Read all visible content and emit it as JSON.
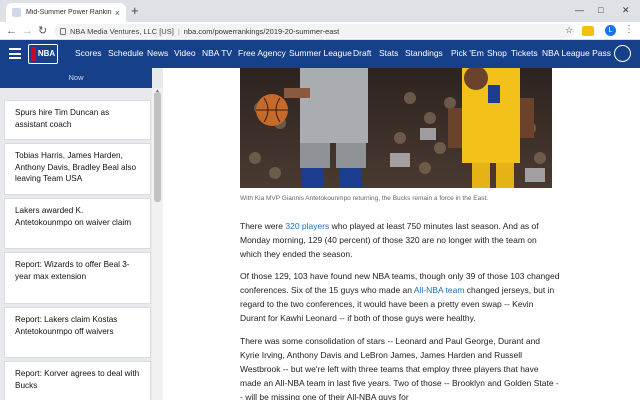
{
  "browser": {
    "tab_title": "Mid-Summer Power Rankings: M",
    "tab_close": "×",
    "new_tab": "+",
    "window_controls": [
      "—",
      "□",
      "✕"
    ],
    "site_name": "NBA Media Ventures, LLC [US]",
    "separator": "|",
    "url": "nba.com/powerrankings/2019-20-summer-east",
    "avatar_letter": "L"
  },
  "nav": {
    "links": [
      "Scores",
      "Schedule",
      "News",
      "Video",
      "NBA TV",
      "Free Agency",
      "Summer League",
      "Draft",
      "Stats",
      "Standings",
      "Pick 'Em",
      "Shop",
      "Tickets",
      "NBA League Pass"
    ],
    "logo_text": "NBA"
  },
  "sidebar": {
    "header": "Now",
    "items": [
      "Spurs hire Tim Duncan as assistant coach",
      "Tobias Harris, James Harden, Anthony Davis, Bradley Beal also leaving Team USA",
      "Lakers awarded K. Antetokounmpo on waiver claim",
      "Report: Wizards to offer Beal 3-year max extension",
      "Report: Lakers claim Kostas Antetokounmpo off waivers",
      "Report: Korver agrees to deal with Bucks"
    ]
  },
  "article": {
    "caption": "With Kia MVP Giannis Antetokounmpo returning, the Bucks remain a force in the East.",
    "p1_a": "There were ",
    "p1_link": "320 players",
    "p1_b": " who played at least 750 minutes last season. And as of Monday morning, 129 (40 percent) of those 320 are no longer with the team on which they ended the season.",
    "p2_a": "Of those 129, 103 have found new NBA teams, though only 39 of those 103 changed conferences. Six of the 15 guys who made an ",
    "p2_link": "All-NBA team",
    "p2_b": " changed jerseys, but in regard to the two conferences, it would have been a pretty even swap -- Kevin Durant for Kawhi Leonard -- if both of those guys were healthy.",
    "p3": "There was some consolidation of stars -- Leonard and Paul George, Durant and Kyrie Irving, Anthony Davis and LeBron James, James Harden and Russell Westbrook -- but we're left with three teams that employ three players that have made an All-NBA team in last five years. Two of those -- Brooklyn and Golden State -- will be missing one of their All-NBA guys for"
  },
  "colors": {
    "nba_blue": "#17408b",
    "nba_red": "#c9082a",
    "link_blue": "#1d6fc1"
  }
}
